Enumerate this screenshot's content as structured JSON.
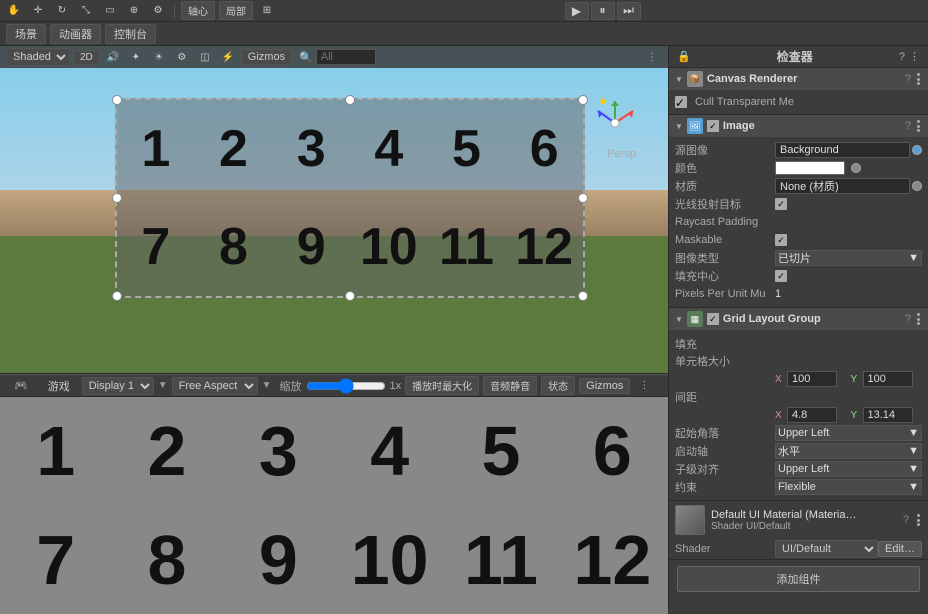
{
  "topToolbar": {
    "tools": [
      "hand",
      "move",
      "rotate",
      "scale",
      "rect",
      "transform"
    ],
    "axisLabel": "轴心",
    "localLabel": "局部",
    "playBtn": "▶",
    "pauseBtn": "⏸",
    "stepBtn": "⏭"
  },
  "secondToolbar": {
    "tabs": [
      "场景",
      "动画器",
      "控制台"
    ],
    "icons": [
      "gear"
    ]
  },
  "sceneToolbar": {
    "shading": "Shaded",
    "mode2d": "2D",
    "audioBtn": "🔊",
    "gizmosBtn": "Gizmos",
    "searchPlaceholder": "All"
  },
  "inspector": {
    "title": "检查器",
    "sections": {
      "canvasRenderer": {
        "name": "Canvas Renderer",
        "cullTransparent": "Cull Transparent Me",
        "cullChecked": true
      },
      "image": {
        "name": "Image",
        "sourceImage": {
          "label": "源图像",
          "value": "Background"
        },
        "color": {
          "label": "颜色"
        },
        "material": {
          "label": "材质",
          "value": "None (材质)"
        },
        "raycastTarget": {
          "label": "光线投射目标"
        },
        "raycastPadding": {
          "label": "Raycast Padding"
        },
        "maskable": {
          "label": "Maskable"
        },
        "imageType": {
          "label": "图像类型",
          "value": "已切片"
        },
        "fillCenter": {
          "label": "填充中心"
        },
        "pixelsPerUnit": {
          "label": "Pixels Per Unit Mu",
          "value": "1"
        }
      },
      "gridLayoutGroup": {
        "name": "Grid Layout Group",
        "fill": {
          "label": "填充"
        },
        "cellSize": {
          "label": "单元格大小",
          "x": "100",
          "y": "100"
        },
        "spacing": {
          "label": "间距",
          "x": "4.8",
          "y": "13.14"
        },
        "startCorner": {
          "label": "起始角落",
          "value": "Upper Left"
        },
        "startAxis": {
          "label": "启动轴",
          "value": "水平"
        },
        "childAlignment": {
          "label": "子级对齐",
          "value": "Upper Left"
        },
        "constraint": {
          "label": "约束",
          "value": "Flexible"
        }
      },
      "defaultUIMaterial": {
        "name": "Default UI Material (Materia…",
        "shader": "UI/Default",
        "editBtn": "Edit…"
      }
    },
    "addComponentBtn": "添加组件"
  },
  "gameView": {
    "label": "游戏",
    "display": "Display 1",
    "aspect": "Free Aspect",
    "scaleLabel": "缩放",
    "scaleValue": "1x",
    "maximizeBtn": "播放时最大化",
    "muteBtn": "音频静音",
    "stateBtn": "状态",
    "gizmosBtn": "Gizmos",
    "numbers": [
      "1",
      "2",
      "3",
      "4",
      "5",
      "6",
      "7",
      "8",
      "9",
      "10",
      "11",
      "12"
    ]
  },
  "sceneNumbers": [
    "1",
    "2",
    "3",
    "4",
    "5",
    "6",
    "7",
    "8",
    "9",
    "10",
    "11",
    "12"
  ],
  "perspLabel": "Persp"
}
